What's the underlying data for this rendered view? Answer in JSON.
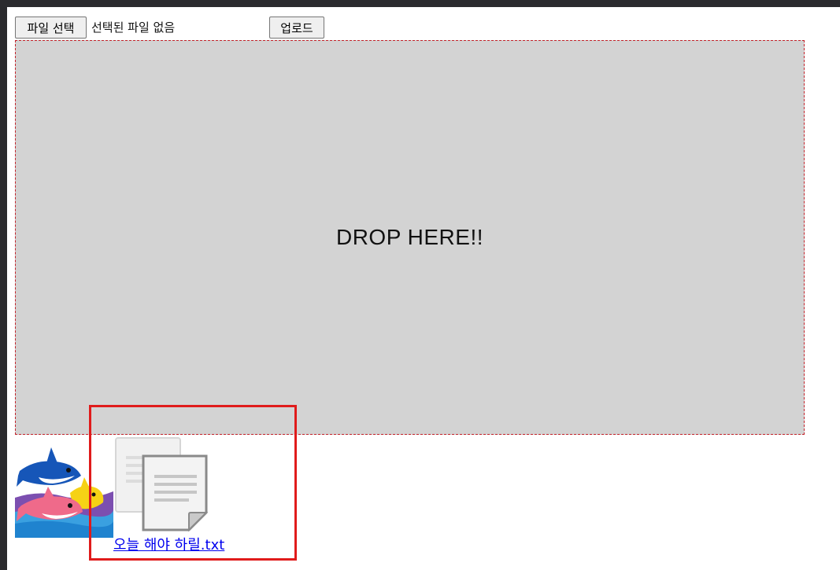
{
  "uploader": {
    "choose_file_label": "파일 선택",
    "file_status": "선택된 파일 없음",
    "upload_label": "업로드"
  },
  "dropzone": {
    "text": "DROP HERE!!"
  },
  "files": [
    {
      "type": "image",
      "icon": "shark-image"
    },
    {
      "type": "document",
      "icon": "document-icon",
      "name": "오늘 해야 하릴.txt"
    }
  ],
  "colors": {
    "dropzone_bg": "#d3d3d3",
    "dropzone_border": "#c2222a",
    "link": "#0000ee",
    "highlight": "#e01b1b"
  }
}
